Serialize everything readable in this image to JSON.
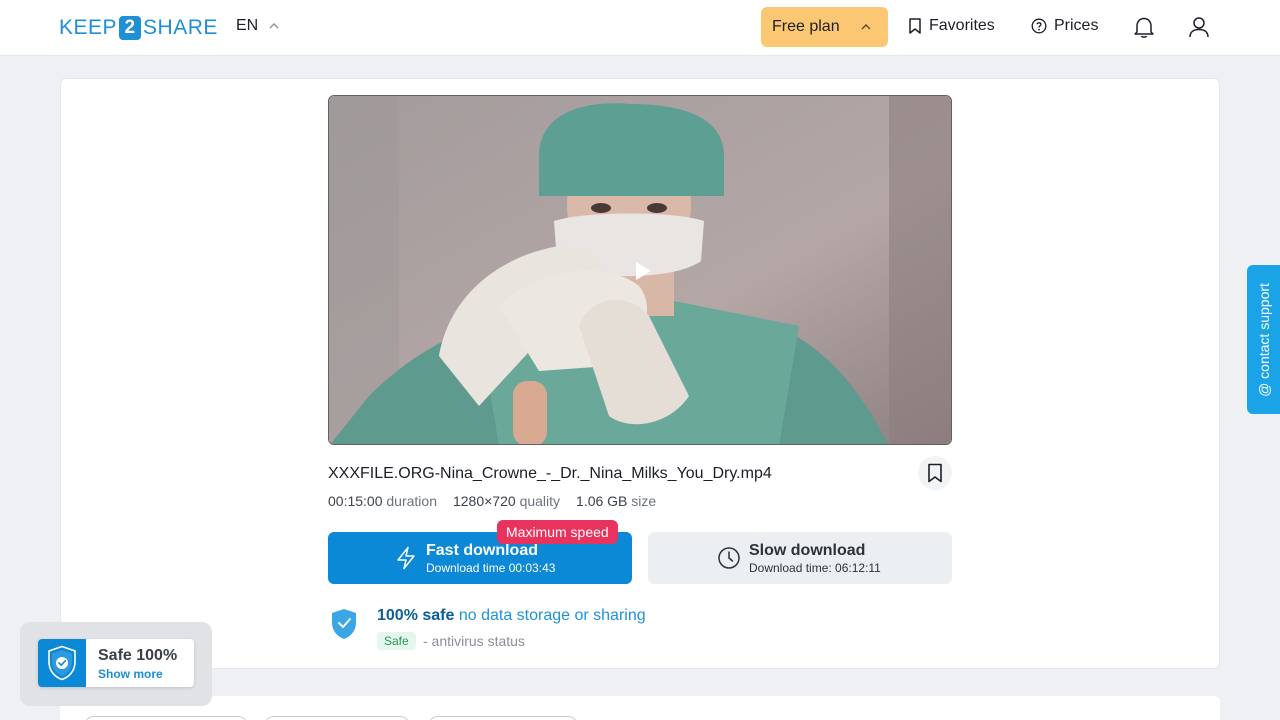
{
  "header": {
    "logo_left": "KEEP",
    "logo_mid": "2",
    "logo_right": "SHARE",
    "language": "EN",
    "plan_label": "Free plan",
    "favorites_label": "Favorites",
    "prices_label": "Prices"
  },
  "file": {
    "name": "XXXFILE.ORG-Nina_Crowne_-_Dr._Nina_Milks_You_Dry.mp4",
    "duration_value": "00:15:00",
    "duration_label": "duration",
    "quality_value": "1280×720",
    "quality_label": "quality",
    "size_value": "1.06 GB",
    "size_label": "size"
  },
  "download": {
    "badge": "Maximum speed",
    "fast_title": "Fast download",
    "fast_subtitle": "Download time 00:03:43",
    "slow_title": "Slow download",
    "slow_subtitle": "Download time: 06:12:11"
  },
  "safety": {
    "headline_strong": "100% safe",
    "headline_rest": "no data storage or sharing",
    "status_tag": "Safe",
    "status_text": "- antivirus status"
  },
  "support": {
    "label": "@ contact support"
  },
  "safe_widget": {
    "title": "Safe 100%",
    "link": "Show more"
  },
  "colors": {
    "brand": "#1f8fd6",
    "fast_button": "#0b88d6",
    "plan_button": "#fcc772",
    "badge": "#e8335f"
  }
}
